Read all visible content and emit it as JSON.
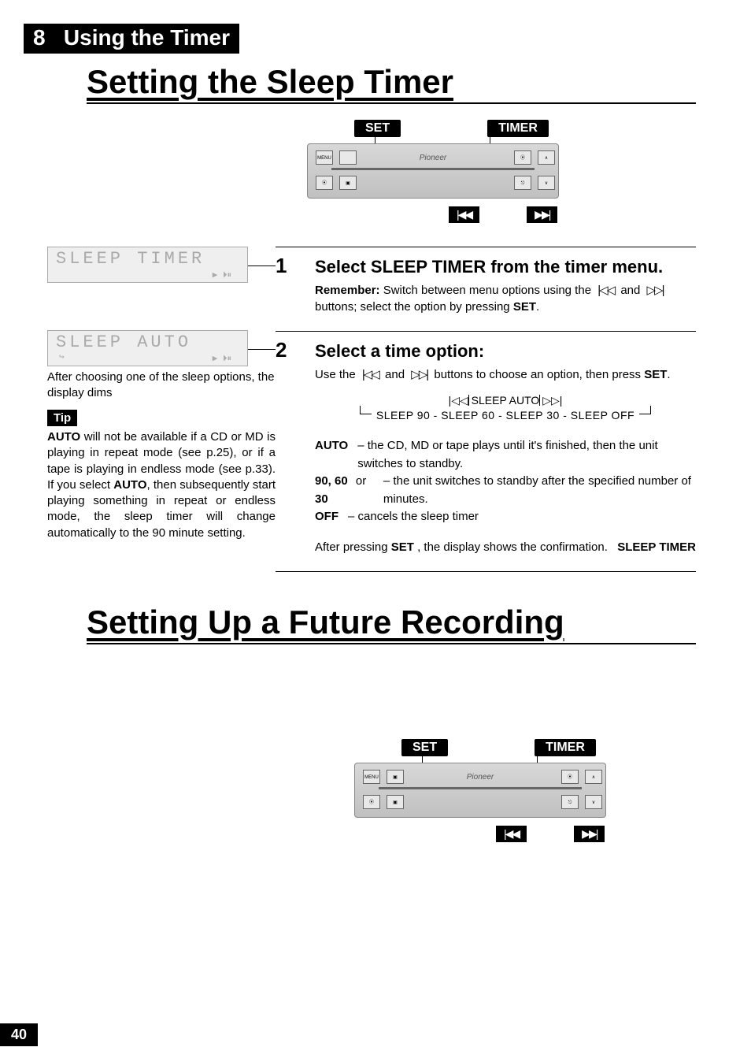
{
  "chapter": {
    "num": "8",
    "title": "Using the Timer"
  },
  "heading1": "Setting the Sleep Timer",
  "heading2": "Setting Up a Future Recording",
  "remote": {
    "set_label": "SET",
    "timer_label": "TIMER",
    "brand": "Pioneer",
    "prev": "|◀◀",
    "next": "▶▶|",
    "menu": "MENU",
    "up": "∧",
    "down": "∨"
  },
  "lcd1": {
    "text": "SLEEP TIMER",
    "sub": "▶ ⏵⏸"
  },
  "lcd2": {
    "text": "SLEEP  AUTO",
    "sub": "▶ ⏵⏸",
    "arrow": "↪"
  },
  "lcd2_caption": "After choosing one of the sleep options, the display dims",
  "tip": {
    "head": "Tip",
    "body_pre": "AUTO",
    "body_1": " will not be available if a CD or MD is playing in repeat mode (see p.25), or if a tape is playing in endless mode (see p.33). If you select ",
    "body_mid": "AUTO",
    "body_2": ", then subsequently start playing something in repeat or endless mode, the sleep timer will change automatically to the 90 minute setting."
  },
  "step1": {
    "num": "1",
    "title": "Select SLEEP TIMER from the timer menu.",
    "sub_label": "Remember:",
    "sub_text_a": " Switch between menu options using the ",
    "sub_text_b": " buttons; select the option by pressing ",
    "sub_set": "SET",
    "prev_icon": "|◁◁",
    "next_icon": "▷▷|"
  },
  "step2": {
    "num": "2",
    "title": "Select a time option:",
    "line1_a": "Use the ",
    "line1_b": " buttons to choose an option, then press ",
    "line1_set": "SET",
    "diag_center": "|◁◁ SLEEP AUTO ▷▷|",
    "diag_row": "SLEEP 90 - SLEEP 60 - SLEEP 30 - SLEEP OFF",
    "def_auto_k": "AUTO",
    "def_auto_v": " – the CD, MD or tape plays until it's finished, then the unit switches to standby.",
    "def_90_k": "90, 60",
    "def_90_or": " or ",
    "def_90_k2": "30",
    "def_90_v": " – the unit switches to standby after the specified number of minutes.",
    "def_off_k": "OFF",
    "def_off_v": " – cancels the sleep timer",
    "footer_a": "After pressing ",
    "footer_set": "SET",
    "footer_b": ", the display shows the ",
    "footer_c": "SLEEP TIMER",
    "footer_d": " confirmation."
  },
  "chart_data": {
    "type": "table",
    "title": "Sleep timer options cycle",
    "categories": [
      "SLEEP AUTO",
      "SLEEP 90",
      "SLEEP 60",
      "SLEEP 30",
      "SLEEP OFF"
    ]
  },
  "page_number": "40"
}
